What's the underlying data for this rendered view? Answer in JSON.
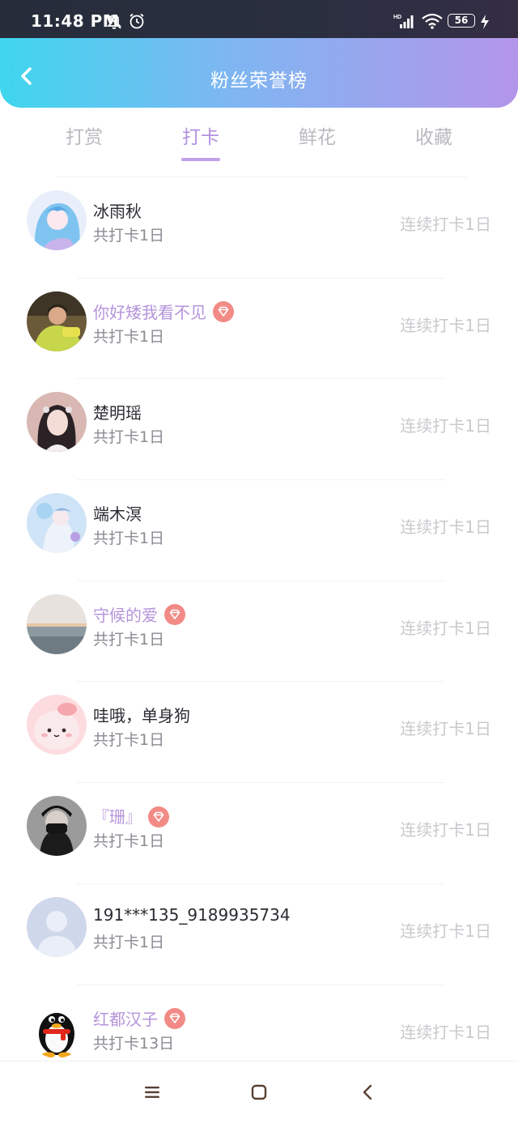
{
  "status_bar": {
    "time": "11:48 PM",
    "battery": "56"
  },
  "header": {
    "title": "粉丝荣誉榜"
  },
  "tabs": [
    {
      "label": "打赏",
      "active": false
    },
    {
      "label": "打卡",
      "active": true
    },
    {
      "label": "鲜花",
      "active": false
    },
    {
      "label": "收藏",
      "active": false
    }
  ],
  "fans": [
    {
      "name": "冰雨秋",
      "vip": false,
      "total": "共打卡1日",
      "streak": "连续打卡1日",
      "avatar": "anime-blue"
    },
    {
      "name": "你好矮我看不见",
      "vip": true,
      "total": "共打卡1日",
      "streak": "连续打卡1日",
      "avatar": "person-green"
    },
    {
      "name": "楚明瑶",
      "vip": false,
      "total": "共打卡1日",
      "streak": "连续打卡1日",
      "avatar": "girl-portrait"
    },
    {
      "name": "端木溟",
      "vip": false,
      "total": "共打卡1日",
      "streak": "连续打卡1日",
      "avatar": "anime-light"
    },
    {
      "name": "守候的爱",
      "vip": true,
      "total": "共打卡1日",
      "streak": "连续打卡1日",
      "avatar": "sea-sunset"
    },
    {
      "name": "哇哦，单身狗",
      "vip": false,
      "total": "共打卡1日",
      "streak": "连续打卡1日",
      "avatar": "pink-cartoon"
    },
    {
      "name": "『珊』",
      "vip": true,
      "total": "共打卡1日",
      "streak": "连续打卡1日",
      "avatar": "masked-person"
    },
    {
      "name": "191***135_9189935734",
      "vip": false,
      "total": "共打卡1日",
      "streak": "连续打卡1日",
      "avatar": "default-user"
    },
    {
      "name": "红都汉子",
      "vip": true,
      "total": "共打卡13日",
      "streak": "连续打卡1日",
      "avatar": "qq-penguin"
    }
  ],
  "colors": {
    "header_gradient_start": "#3fd6ee",
    "header_gradient_end": "#b395ea",
    "accent_purple": "#b391e0",
    "vip_badge": "#f07a7a"
  },
  "icons": {
    "back": "chevron-left-icon",
    "vip": "diamond-icon",
    "nav_menu": "menu-icon",
    "nav_home": "square-icon",
    "nav_back": "back-triangle-icon"
  }
}
